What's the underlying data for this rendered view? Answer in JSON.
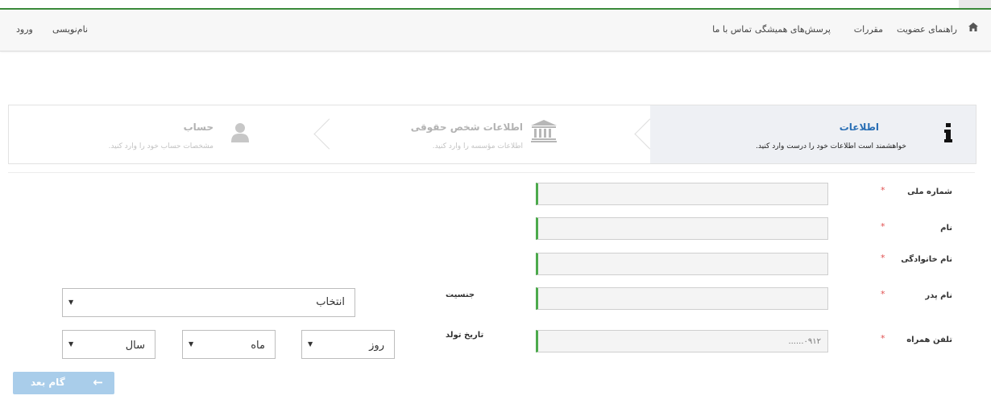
{
  "nav": {
    "home_icon": "home-icon",
    "membership_guide": "راهنمای عضویت",
    "rules": "مقررات",
    "faq": "پرسش‌های همیشگی",
    "contact": "تماس با ما",
    "register": "نام‌نویسی",
    "login": "ورود"
  },
  "steps": [
    {
      "title": "اطلاعات",
      "desc": "خواهشمند است اطلاعات خود را درست وارد کنید.",
      "icon": "info-icon"
    },
    {
      "title": "اطلاعات شخص حقوقی",
      "desc": "اطلاعات مؤسسه را وارد کنید.",
      "icon": "bank-icon"
    },
    {
      "title": "حساب",
      "desc": "مشخصات حساب خود را وارد کنید.",
      "icon": "user-icon"
    }
  ],
  "form": {
    "required_mark": "*",
    "national_id_label": "شماره ملی",
    "first_name_label": "نام",
    "last_name_label": "نام خانوادگی",
    "father_name_label": "نام پدر",
    "mobile_label": "تلفن همراه",
    "mobile_placeholder": "۰۹۱۲......",
    "gender_label": "جنسیت",
    "gender_value": "انتخاب",
    "birth_label": "تاریخ تولد",
    "day_value": "روز",
    "month_value": "ماه",
    "year_value": "سال"
  },
  "next_button": {
    "label": "گام بعد"
  },
  "colors": {
    "accent_green": "#4caa4c",
    "active_blue": "#2a6fb5",
    "button_blue": "#a9cdea",
    "required_red": "#e05050"
  }
}
